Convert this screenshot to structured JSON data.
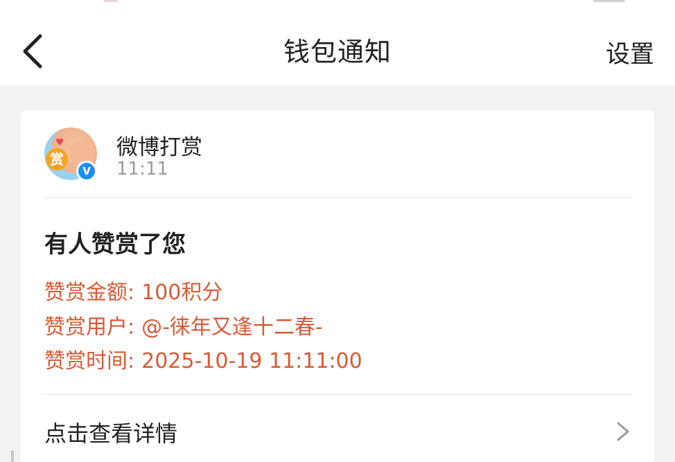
{
  "header": {
    "title": "钱包通知",
    "settings_label": "设置",
    "back_icon": "chevron-left-icon"
  },
  "message": {
    "sender": "微博打赏",
    "time": "11:11",
    "avatar_badge_char": "赏",
    "verified_char": "V",
    "title": "有人赞赏了您",
    "details": [
      {
        "label": "赞赏金额:",
        "value": "100积分"
      },
      {
        "label": "赞赏用户:",
        "value": "@-徕年又逢十二春-"
      },
      {
        "label": "赞赏时间:",
        "value": "2025-10-19 11:11:00"
      }
    ],
    "view_details_label": "点击查看详情",
    "chevron_icon": "chevron-right-icon"
  },
  "colors": {
    "accent_text": "#d65a35",
    "verified_blue": "#1e8ff0",
    "background": "#f2f2f2"
  }
}
